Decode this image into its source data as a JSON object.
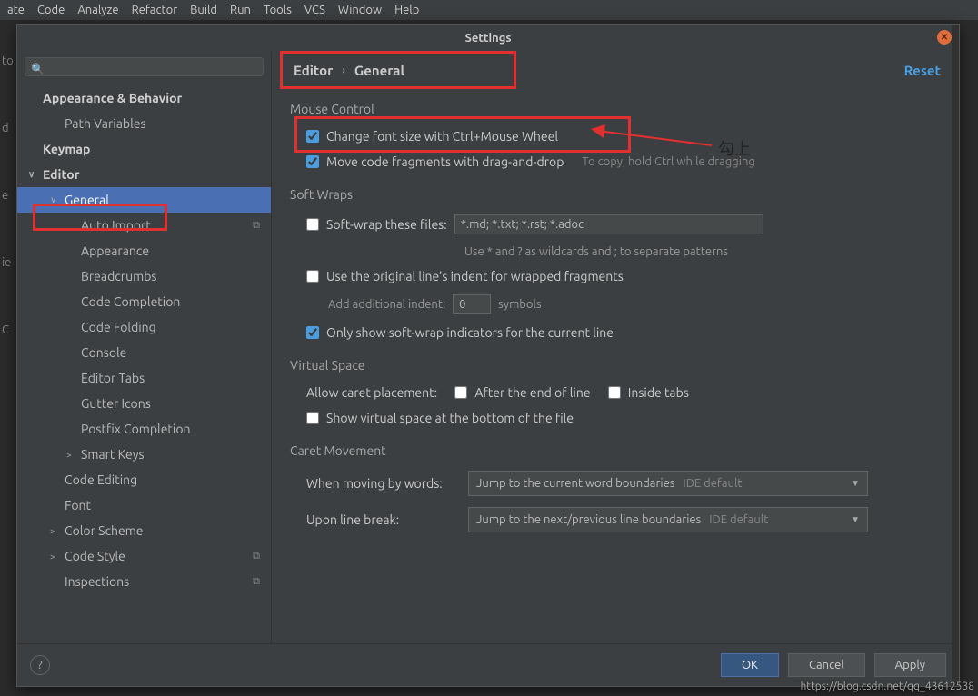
{
  "menubar": [
    "ate",
    "Code",
    "Analyze",
    "Refactor",
    "Build",
    "Run",
    "Tools",
    "VCS",
    "Window",
    "Help"
  ],
  "menubar_underline": [
    "",
    "C",
    "A",
    "R",
    "B",
    "R",
    "T",
    "S",
    "W",
    "H"
  ],
  "dialog_title": "Settings",
  "search_placeholder": "",
  "sidebar": {
    "items": [
      {
        "label": "Appearance & Behavior",
        "bold": true,
        "level": 0,
        "chev": ""
      },
      {
        "label": "Path Variables",
        "level": 1
      },
      {
        "label": "Keymap",
        "bold": true,
        "level": 0
      },
      {
        "label": "Editor",
        "bold": true,
        "level": 0,
        "chev": "∨"
      },
      {
        "label": "General",
        "level": 1,
        "chev": "∨",
        "selected": true
      },
      {
        "label": "Auto Import",
        "level": 2,
        "copy": true
      },
      {
        "label": "Appearance",
        "level": 2
      },
      {
        "label": "Breadcrumbs",
        "level": 2
      },
      {
        "label": "Code Completion",
        "level": 2
      },
      {
        "label": "Code Folding",
        "level": 2
      },
      {
        "label": "Console",
        "level": 2
      },
      {
        "label": "Editor Tabs",
        "level": 2
      },
      {
        "label": "Gutter Icons",
        "level": 2
      },
      {
        "label": "Postfix Completion",
        "level": 2
      },
      {
        "label": "Smart Keys",
        "level": 2,
        "chev": ">"
      },
      {
        "label": "Code Editing",
        "level": 1
      },
      {
        "label": "Font",
        "level": 1
      },
      {
        "label": "Color Scheme",
        "level": 1,
        "chev": ">"
      },
      {
        "label": "Code Style",
        "level": 1,
        "chev": ">",
        "copy": true
      },
      {
        "label": "Inspections",
        "level": 1,
        "copy": true
      }
    ]
  },
  "breadcrumb": {
    "a": "Editor",
    "b": "General"
  },
  "reset_label": "Reset",
  "sections": {
    "mouse": {
      "title": "Mouse Control",
      "change_font": "Change font size with Ctrl+Mouse Wheel",
      "move_frag": "Move code fragments with drag-and-drop",
      "move_hint": "To copy, hold Ctrl while dragging"
    },
    "soft": {
      "title": "Soft Wraps",
      "wrap_files": "Soft-wrap these files:",
      "wrap_value": "*.md; *.txt; *.rst; *.adoc",
      "wrap_hint": "Use * and ? as wildcards and ; to separate patterns",
      "orig_indent": "Use the original line's indent for wrapped fragments",
      "add_indent": "Add additional indent:",
      "add_indent_val": "0",
      "symbols": "symbols",
      "only_show": "Only show soft-wrap indicators for the current line"
    },
    "virtual": {
      "title": "Virtual Space",
      "allow": "Allow caret placement:",
      "after_eol": "After the end of line",
      "inside_tabs": "Inside tabs",
      "show_bottom": "Show virtual space at the bottom of the file"
    },
    "caret": {
      "title": "Caret Movement",
      "by_words": "When moving by words:",
      "by_words_val": "Jump to the current word boundaries",
      "line_break": "Upon line break:",
      "line_break_val": "Jump to the next/previous line boundaries",
      "def": "IDE default"
    }
  },
  "buttons": {
    "ok": "OK",
    "cancel": "Cancel",
    "apply": "Apply"
  },
  "annotation_text": "勾上",
  "watermark": "https://blog.csdn.net/qq_43612538",
  "side_fragments": [
    "to",
    "d",
    "e",
    "ie",
    "C"
  ]
}
